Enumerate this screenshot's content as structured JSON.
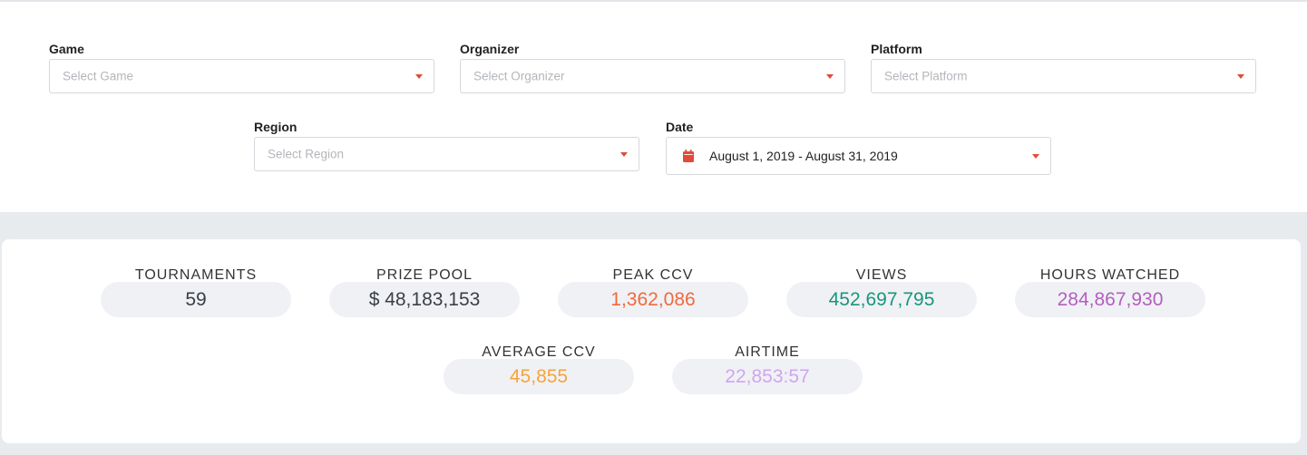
{
  "filters": {
    "game": {
      "label": "Game",
      "placeholder": "Select Game"
    },
    "organizer": {
      "label": "Organizer",
      "placeholder": "Select Organizer"
    },
    "platform": {
      "label": "Platform",
      "placeholder": "Select Platform"
    },
    "region": {
      "label": "Region",
      "placeholder": "Select Region"
    },
    "date": {
      "label": "Date",
      "value": "August 1, 2019 - August 31, 2019",
      "icon": "calendar-icon"
    }
  },
  "stats": {
    "tournaments": {
      "label": "TOURNAMENTS",
      "value": "59",
      "color": "#3a3f45"
    },
    "prize_pool": {
      "label": "PRIZE POOL",
      "value": "$ 48,183,153",
      "color": "#3a3f45"
    },
    "peak_ccv": {
      "label": "PEAK CCV",
      "value": "1,362,086",
      "color": "#f06a3a"
    },
    "views": {
      "label": "VIEWS",
      "value": "452,697,795",
      "color": "#17977b"
    },
    "hours_watched": {
      "label": "HOURS WATCHED",
      "value": "284,867,930",
      "color": "#b25fc0"
    },
    "average_ccv": {
      "label": "AVERAGE CCV",
      "value": "45,855",
      "color": "#f7a43a"
    },
    "airtime": {
      "label": "AIRTIME",
      "value": "22,853:57",
      "color": "#cfa6f0"
    }
  },
  "colors": {
    "accent": "#e04b3a",
    "page_background": "#e8ebee",
    "pill_background": "#f0f1f5"
  }
}
